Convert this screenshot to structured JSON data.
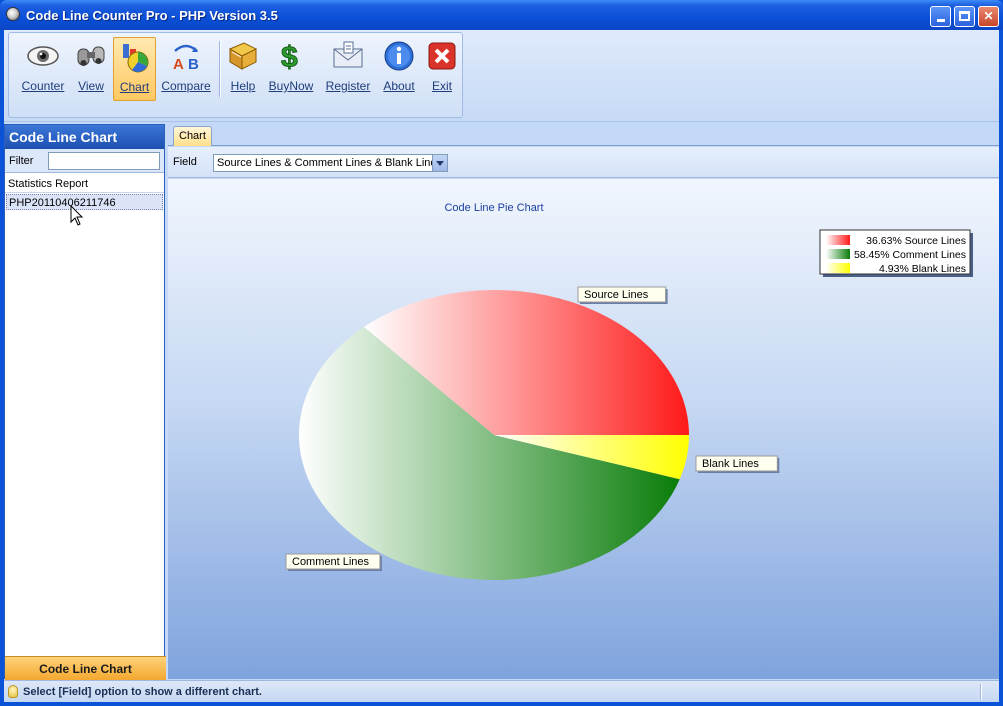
{
  "window": {
    "title": "Code Line Counter Pro - PHP Version 3.5"
  },
  "toolbar": {
    "items": [
      {
        "label": "Counter",
        "icon": "eye-icon"
      },
      {
        "label": "View",
        "icon": "binoculars-icon"
      },
      {
        "label": "Chart",
        "icon": "chart-icon",
        "active": true
      },
      {
        "label": "Compare",
        "icon": "compare-ab-icon"
      },
      {
        "label": "Help",
        "icon": "help-book-icon"
      },
      {
        "label": "BuyNow",
        "icon": "dollar-icon"
      },
      {
        "label": "Register",
        "icon": "register-envelope-icon"
      },
      {
        "label": "About",
        "icon": "info-icon"
      },
      {
        "label": "Exit",
        "icon": "exit-x-icon"
      }
    ]
  },
  "left_panel": {
    "title": "Code Line Chart",
    "filter_label": "Filter",
    "filter_value": "",
    "tree_header": "Statistics Report",
    "selected_item": "PHP20110406211746",
    "footer_label": "Code Line Chart"
  },
  "right_panel": {
    "tab_label": "Chart",
    "field_label": "Field",
    "field_value": "Source Lines & Comment Lines & Blank Lines"
  },
  "chart_data": {
    "type": "pie",
    "title": "Code Line Pie Chart",
    "categories": [
      "Source Lines",
      "Comment Lines",
      "Blank Lines"
    ],
    "values": [
      36.63,
      58.45,
      4.93
    ],
    "colors": [
      "#ff1a1a",
      "#0a7d0a",
      "#ffff00"
    ],
    "legend": [
      "36.63% Source Lines",
      "58.45% Comment Lines",
      "4.93% Blank Lines"
    ],
    "legend_position": "top-right"
  },
  "status": {
    "text": "Select [Field] option to show a different chart."
  }
}
